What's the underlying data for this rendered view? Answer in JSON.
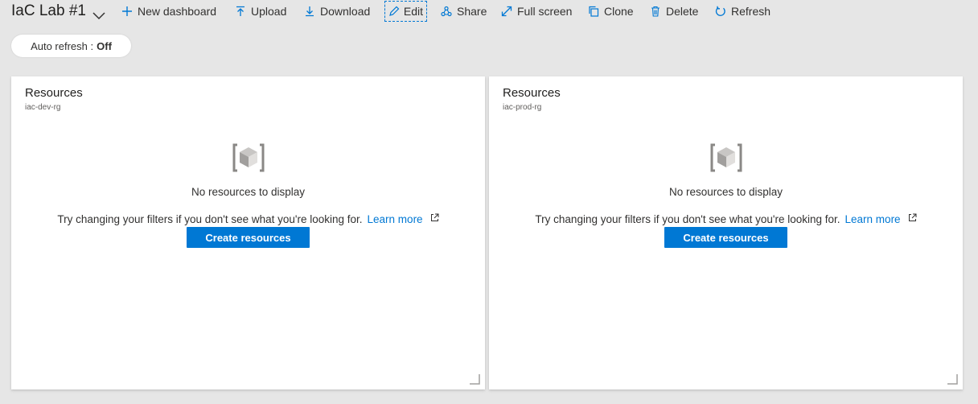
{
  "dashboard": {
    "title": "IaC Lab #1"
  },
  "toolbar": {
    "new_dashboard": "New dashboard",
    "upload": "Upload",
    "download": "Download",
    "edit": "Edit",
    "share": "Share",
    "full_screen": "Full screen",
    "clone": "Clone",
    "delete": "Delete",
    "refresh": "Refresh"
  },
  "auto_refresh": {
    "label": "Auto refresh :",
    "value": "Off"
  },
  "tiles": [
    {
      "title": "Resources",
      "subtitle": "iac-dev-rg",
      "empty_message": "No resources to display",
      "hint": "Try changing your filters if you don't see what you're looking for.",
      "learn_more": "Learn more",
      "create_button": "Create resources"
    },
    {
      "title": "Resources",
      "subtitle": "iac-prod-rg",
      "empty_message": "No resources to display",
      "hint": "Try changing your filters if you don't see what you're looking for.",
      "learn_more": "Learn more",
      "create_button": "Create resources"
    }
  ],
  "colors": {
    "accent": "#0078d4",
    "background": "#e6e6e6",
    "tile": "#ffffff"
  },
  "icons": [
    "chevron-down-icon",
    "plus-icon",
    "upload-icon",
    "download-icon",
    "edit-icon",
    "share-icon",
    "full-screen-icon",
    "clone-icon",
    "delete-icon",
    "refresh-icon",
    "resource-cube-icon",
    "external-link-icon",
    "resize-handle-icon"
  ]
}
